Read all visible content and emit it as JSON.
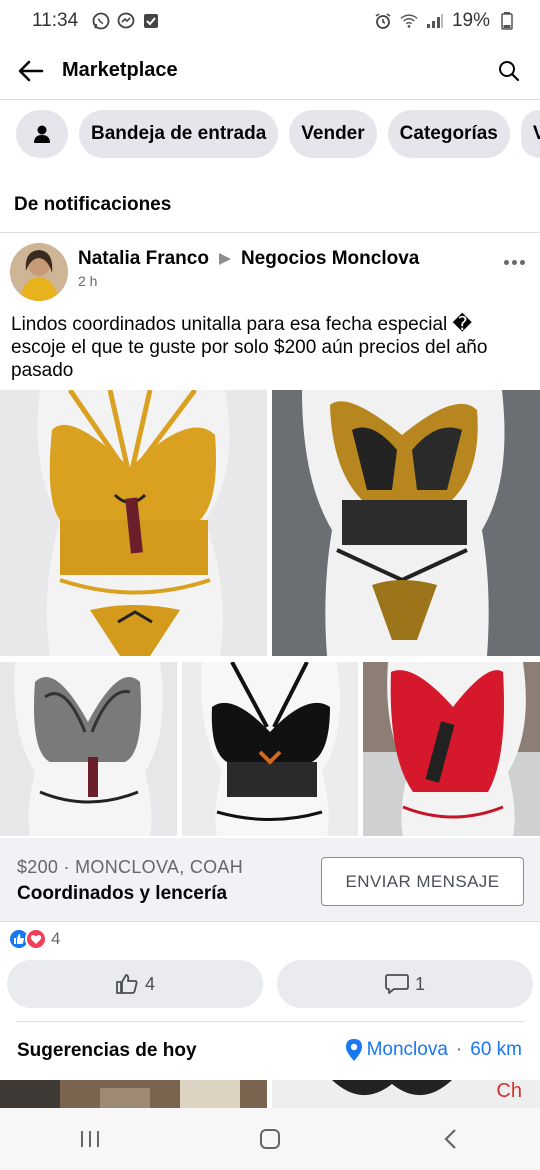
{
  "status_bar": {
    "time": "11:34",
    "battery": "19%",
    "left_icons": [
      "whatsapp-icon",
      "messenger-icon",
      "download-icon"
    ],
    "right_icons": [
      "alarm-icon",
      "wifi-icon",
      "signal-icon",
      "battery-icon"
    ]
  },
  "header": {
    "title": "Marketplace"
  },
  "chips": {
    "inbox": "Bandeja de entrada",
    "sell": "Vender",
    "categories": "Categorías",
    "partial": "V"
  },
  "section": {
    "title": "De notificaciones"
  },
  "post": {
    "author": "Natalia Franco",
    "group": "Negocios Monclova",
    "time": "2 h",
    "text": "Lindos coordinados unitalla para esa fecha especial � escoje el que te guste por solo $200  aún precios del año pasado"
  },
  "listing": {
    "price_location": "$200 · MONCLOVA, COAH",
    "title": "Coordinados y lencería",
    "button": "ENVIAR MENSAJE"
  },
  "reactions": {
    "count": "4"
  },
  "actions": {
    "like_count": "4",
    "comment_count": "1"
  },
  "suggestions": {
    "title": "Sugerencias de hoy",
    "location": "Monclova",
    "separator": "·",
    "distance": "60 km",
    "partial_text": "Ch"
  },
  "colors": {
    "accent": "#1877f2",
    "chip_bg": "#e4e6eb",
    "listing_bg": "#f0f2f5"
  }
}
